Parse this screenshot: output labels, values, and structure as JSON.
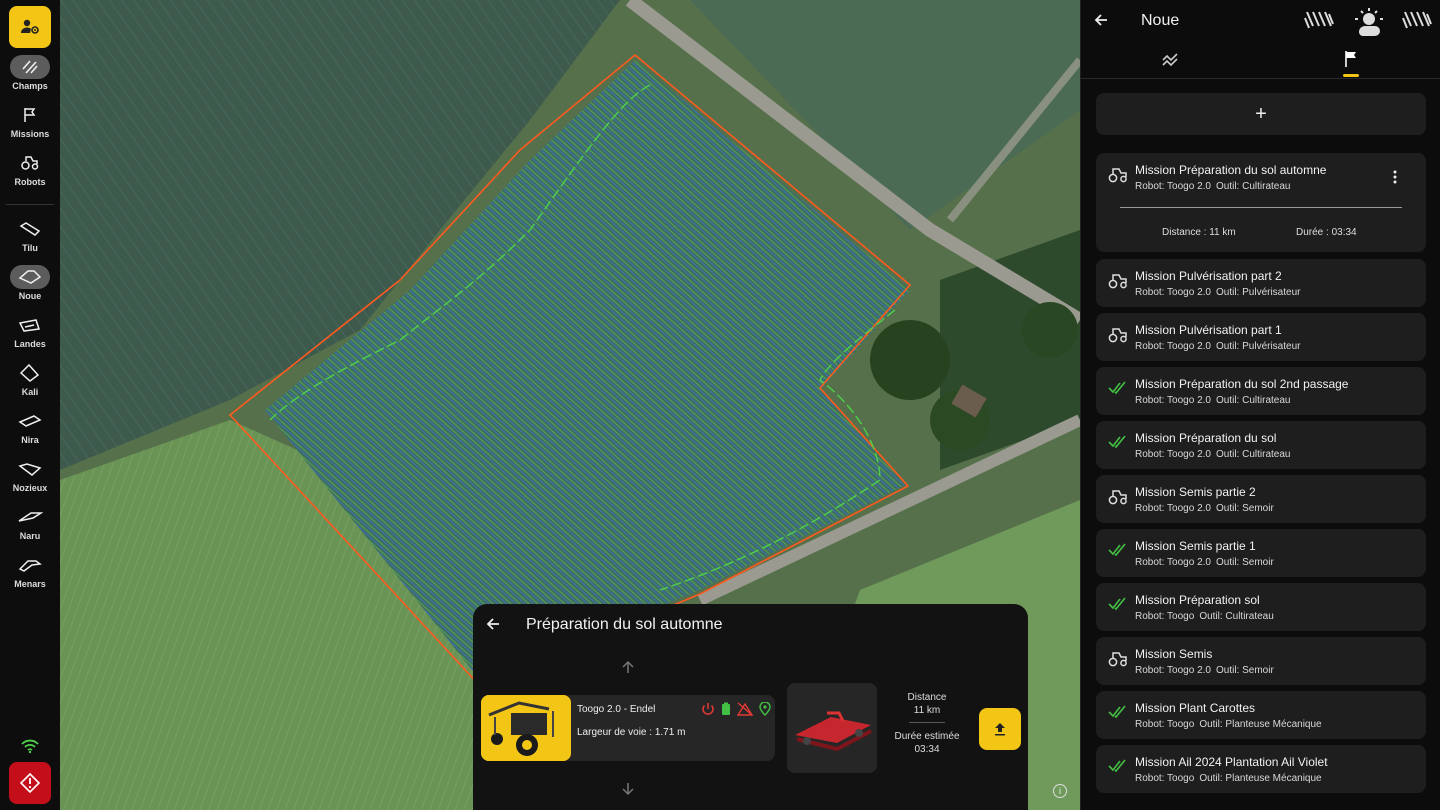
{
  "nav": {
    "items": [
      {
        "label": "Champs",
        "icon": "fields-icon",
        "active": true
      },
      {
        "label": "Missions",
        "icon": "flag-icon"
      },
      {
        "label": "Robots",
        "icon": "tractor-icon"
      }
    ],
    "fields": [
      {
        "label": "Tilu"
      },
      {
        "label": "Noue",
        "active": true
      },
      {
        "label": "Landes"
      },
      {
        "label": "Kali"
      },
      {
        "label": "Nira"
      },
      {
        "label": "Nozieux"
      },
      {
        "label": "Naru"
      },
      {
        "label": "Menars"
      }
    ]
  },
  "mission_card": {
    "title": "Préparation du sol automne",
    "robot_name": "Toogo 2.0 - Endel",
    "track_width": "Largeur de voie : 1.71 m",
    "distance_label": "Distance",
    "distance_value": "11 km",
    "duration_label": "Durée estimée",
    "duration_value": "03:34",
    "status_colors": {
      "power": "#e53935",
      "battery": "#43c043",
      "no_implement": "#e53935",
      "location": "#43c043"
    }
  },
  "panel": {
    "title": "Noue",
    "add_label": "+",
    "expanded_distance": "Distance : 11 km",
    "expanded_duration": "Durée : 03:34",
    "missions": [
      {
        "title": "Mission Préparation du sol automne",
        "robot": "Robot: Toogo 2.0",
        "tool": "Outil: Cultirateau",
        "status": "planned"
      },
      {
        "title": "Mission Pulvérisation part 2",
        "robot": "Robot: Toogo 2.0",
        "tool": "Outil: Pulvérisateur",
        "status": "planned"
      },
      {
        "title": "Mission Pulvérisation part 1",
        "robot": "Robot: Toogo 2.0",
        "tool": "Outil: Pulvérisateur",
        "status": "planned"
      },
      {
        "title": "Mission Préparation du sol 2nd passage",
        "robot": "Robot: Toogo 2.0",
        "tool": "Outil: Cultirateau",
        "status": "done"
      },
      {
        "title": "Mission Préparation du sol",
        "robot": "Robot: Toogo 2.0",
        "tool": "Outil: Cultirateau",
        "status": "done"
      },
      {
        "title": "Mission Semis partie 2",
        "robot": "Robot: Toogo 2.0",
        "tool": "Outil: Semoir",
        "status": "planned"
      },
      {
        "title": "Mission Semis partie 1",
        "robot": "Robot: Toogo 2.0",
        "tool": "Outil: Semoir",
        "status": "done"
      },
      {
        "title": "Mission Préparation sol",
        "robot": "Robot: Toogo",
        "tool": "Outil: Cultirateau",
        "status": "done"
      },
      {
        "title": "Mission Semis",
        "robot": "Robot: Toogo 2.0",
        "tool": "Outil: Semoir",
        "status": "planned"
      },
      {
        "title": "Mission Plant Carottes",
        "robot": "Robot: Toogo",
        "tool": "Outil: Planteuse Mécanique",
        "status": "done"
      },
      {
        "title": "Mission Ail 2024 Plantation Ail Violet",
        "robot": "Robot: Toogo",
        "tool": "Outil: Planteuse Mécanique",
        "status": "done"
      }
    ]
  },
  "colors": {
    "accent": "#f3c514",
    "alert": "#c40f1b",
    "boundary": "#ff5a1f",
    "path": "#4fd14a",
    "rows": "#3b6fd6",
    "done": "#43c043"
  }
}
